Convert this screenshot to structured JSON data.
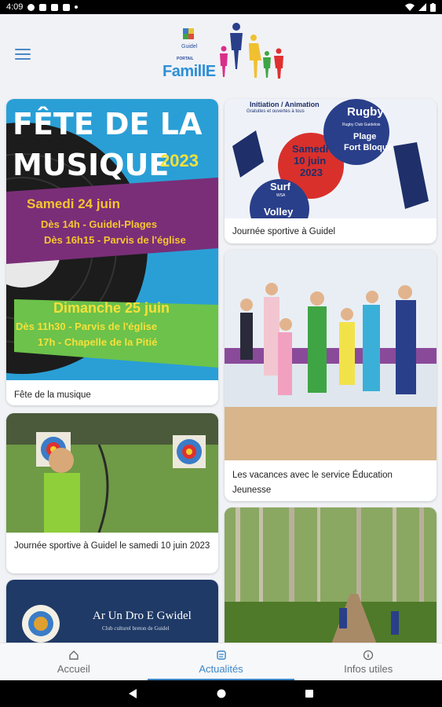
{
  "status_bar": {
    "time": "4:09"
  },
  "header": {
    "logo": {
      "guidel": "Guidel",
      "portail": "PORTAIL",
      "famille": "FamillE"
    }
  },
  "feed": {
    "cards": [
      {
        "caption": "Fête de la musique",
        "poster": {
          "title_line1": "FÊTE DE LA",
          "title_line2": "MUSIQUE",
          "year": "2023",
          "day1": "Samedi 24 juin",
          "day1_line1": "Dès 14h - Guidel-Plages",
          "day1_line2": "Dès 16h15 - Parvis de l'église",
          "day2": "Dimanche 25 juin",
          "day2_line1": "Dès 11h30 - Parvis de l'église",
          "day2_line2": "17h - Chapelle de la Pitié"
        }
      },
      {
        "caption": "Journée sportive à Guidel",
        "poster": {
          "top": "Initiation / Animation",
          "top_sub": "Gratuites et ouvertes à tous",
          "rugby": "Rugby",
          "rugby_sub": "Rugby Club Guidelois",
          "date_line1": "Samedi",
          "date_line2": "10 juin",
          "date_line3": "2023",
          "plage": "Plage",
          "fort": "Fort Bloqué",
          "surf": "Surf",
          "surf_sub": "WSA",
          "volley": "Volley"
        }
      },
      {
        "caption": "Les vacances avec le service Éducation Jeunesse"
      },
      {
        "caption": "Journée sportive à Guidel le samedi 10 juin 2023"
      },
      {
        "caption": "",
        "poster": {
          "title": "Ar Un Dro E Gwidel",
          "subtitle": "Club culturel breton de Guidel"
        }
      },
      {
        "caption": ""
      }
    ]
  },
  "bottom_nav": {
    "items": [
      {
        "label": "Accueil",
        "icon": "home-icon"
      },
      {
        "label": "Actualités",
        "icon": "news-icon"
      },
      {
        "label": "Infos utiles",
        "icon": "info-icon"
      }
    ]
  },
  "colors": {
    "accent": "#3d86c6",
    "background": "#f1f2f6"
  }
}
